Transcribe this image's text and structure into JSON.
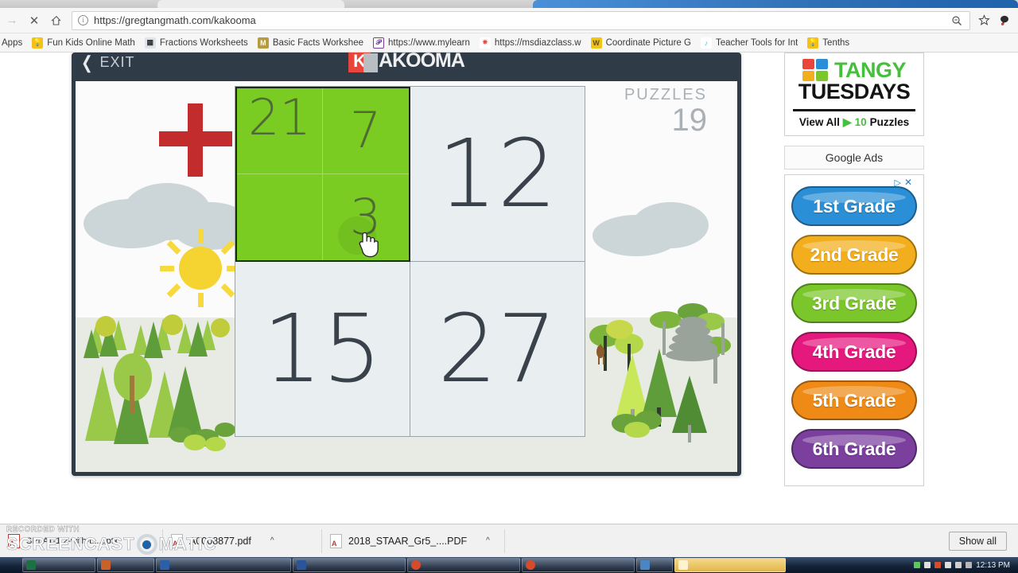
{
  "browser": {
    "url_prefix": "https://",
    "url_domain": "gregtangmath.com",
    "url_path": "/kakooma",
    "url_full": "https://gregtangmath.com/kakooma",
    "back_icon": "back-arrow-icon",
    "close_icon": "close-x-icon",
    "home_icon": "home-icon",
    "info_icon": "info-circle-icon",
    "zoom_icon": "zoom-magnifier-icon",
    "star_icon": "bookmark-star-icon",
    "extension_icon": "extension-icon"
  },
  "bookmarks": {
    "apps_label": "Apps",
    "items": [
      {
        "label": "Fun Kids Online Math",
        "fav": "lightbulb-icon",
        "color": "#f2c21b"
      },
      {
        "label": "Fractions Worksheets",
        "fav": "grid-icon",
        "color": "#d0d6de"
      },
      {
        "label": "Basic Facts Workshee",
        "fav": "m-icon",
        "color": "#b99b3d"
      },
      {
        "label": "https://www.mylearn",
        "fav": "purple-icon",
        "color": "#7a3a9a"
      },
      {
        "label": "https://msdiazclass.w",
        "fav": "pinwheel-icon",
        "color": "#e8453c"
      },
      {
        "label": "Coordinate Picture G",
        "fav": "w-icon",
        "color": "#f0c419"
      },
      {
        "label": "Teacher Tools for Int",
        "fav": "note-icon",
        "color": "#35c0d6"
      },
      {
        "label": "Tenths",
        "fav": "lightbulb-icon",
        "color": "#f2c21b"
      }
    ]
  },
  "game": {
    "exit_label": "EXIT",
    "logo_letter": "K",
    "logo_text": "AKOOMA",
    "puzzles_label": "PUZZLES",
    "puzzles_count": "19",
    "operator": "+",
    "selected_color": "#7ACC22",
    "grid": [
      {
        "value": "21",
        "selected": true,
        "subcells": [
          {
            "value": "21",
            "wide": true
          },
          {
            "value": "7"
          },
          {
            "value": ""
          },
          {
            "value": "3"
          }
        ]
      },
      {
        "value": "12",
        "selected": false
      },
      {
        "value": "15",
        "selected": false
      },
      {
        "value": "27",
        "selected": false
      }
    ],
    "cursor_icon": "pointing-hand-cursor"
  },
  "ads": {
    "tangy": {
      "word1": "TANGY",
      "word2": "TUESDAYS",
      "view_all": "View All",
      "play_icon": "play-triangle-icon",
      "count": "10",
      "count_suffix": "Puzzles"
    },
    "google_ads_label": "Google Ads",
    "adchoices_icon": "adchoices-icon",
    "close_icon": "ad-close-x-icon",
    "grades": [
      {
        "label": "1st Grade",
        "color": "#2a8fd6"
      },
      {
        "label": "2nd Grade",
        "color": "#f2ae1c"
      },
      {
        "label": "3rd Grade",
        "color": "#7bc62b"
      },
      {
        "label": "4th Grade",
        "color": "#e5187e"
      },
      {
        "label": "5th Grade",
        "color": "#ef8a16"
      },
      {
        "label": "6th Grade",
        "color": "#7b3f9d"
      }
    ]
  },
  "downloads": {
    "items": [
      {
        "name": "SPLAT-1.2-with-t....pptx",
        "icon": "pptx-icon",
        "has_caret": false
      },
      {
        "name": "A0008877.pdf",
        "icon": "pdf-icon",
        "has_caret": true
      },
      {
        "name": "2018_STAAR_Gr5_....PDF",
        "icon": "pdf-icon",
        "has_caret": true
      }
    ],
    "show_all_label": "Show all",
    "caret_glyph": "^"
  },
  "watermark": {
    "recorded_with": "RECORDED WITH",
    "brand_left": "SCREENCAST",
    "brand_right": "MATIC"
  },
  "taskbar": {
    "clock": "12:13 PM",
    "items": [
      {
        "color": "#1d7044",
        "name": "excel"
      },
      {
        "color": "#c8622a",
        "name": "explorer"
      },
      {
        "color": "#2b5fa8",
        "name": "window"
      },
      {
        "color": "#2a5699",
        "name": "word"
      },
      {
        "color": "#d64b2c",
        "name": "chrome"
      },
      {
        "color": "#d64b2c",
        "name": "chrome-2"
      },
      {
        "color": "#4b86c4",
        "name": "media"
      },
      {
        "color": "#e3b54a",
        "name": "folder"
      }
    ]
  }
}
